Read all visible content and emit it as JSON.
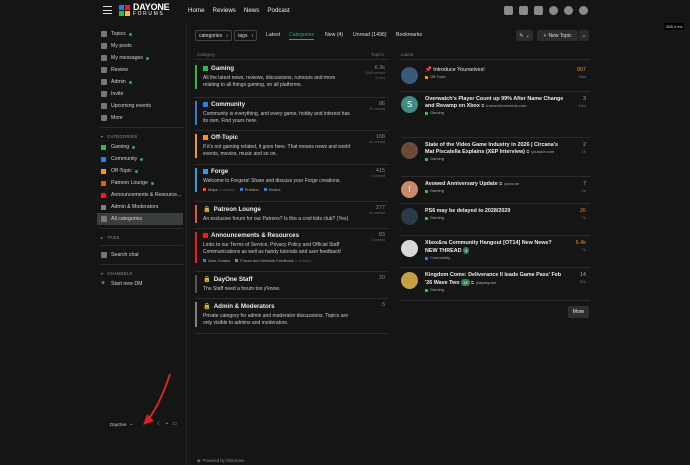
{
  "header": {
    "logo_top": "DAYONE",
    "logo_bottom": "FORUMS",
    "nav": [
      "Home",
      "Reviews",
      "News",
      "Podcast"
    ],
    "icons": [
      "youtube-icon",
      "x-icon",
      "discord-icon",
      "search-icon",
      "chat-icon",
      "user-avatar-icon"
    ],
    "tooltip": "358.4 ms"
  },
  "sidebar": {
    "main": [
      {
        "label": "Topics",
        "icon": "topics-icon",
        "dot": true
      },
      {
        "label": "My posts",
        "icon": "posts-icon",
        "dot": false
      },
      {
        "label": "My messages",
        "icon": "messages-icon",
        "dot": true
      },
      {
        "label": "Review",
        "icon": "review-icon",
        "dot": false
      },
      {
        "label": "Admin",
        "icon": "wrench-icon",
        "dot": true
      },
      {
        "label": "Invite",
        "icon": "invite-icon",
        "dot": false
      },
      {
        "label": "Upcoming events",
        "icon": "calendar-icon",
        "dot": false
      },
      {
        "label": "More",
        "icon": "more-icon",
        "dot": false
      }
    ],
    "categories_heading": "CATEGORIES",
    "categories": [
      {
        "label": "Gaming",
        "color": "#3ab54a",
        "dot": true
      },
      {
        "label": "Community",
        "color": "#2d7ed6",
        "dot": true
      },
      {
        "label": "Off-Topic",
        "color": "#f7941d",
        "dot": true
      },
      {
        "label": "Patreon Lounge",
        "color": "#e45735",
        "dot": true
      },
      {
        "label": "Announcements & Resource...",
        "color": "#ed1c24",
        "dot": true
      },
      {
        "label": "Admin & Moderators",
        "color": "#808281",
        "dot": false
      }
    ],
    "all_categories": "All categories",
    "tags_heading": "TAGS",
    "search_chat": "Search chat",
    "channels_heading": "CHANNELS",
    "start_dm": "Start new DM",
    "footer_label": "DayOne"
  },
  "navbar": {
    "categories_dd": "categories",
    "tags_dd": "tags",
    "tabs": [
      "Latest",
      "Categories",
      "New (4)",
      "Unread (1496)",
      "Bookmarks"
    ],
    "active_tab": "Categories",
    "new_topic": "New Topic"
  },
  "columns": {
    "category": "Category",
    "topics": "Topics",
    "latest": "Latest"
  },
  "categories": [
    {
      "name": "Gaming",
      "color": "#3ab54a",
      "desc": "All the latest news, reviews, discussions, rumours and more relating to all things gaming, on all platforms.",
      "count": "6.3k",
      "stat1": "2069 unread",
      "stat2": "4 new",
      "subs": []
    },
    {
      "name": "Community",
      "color": "#2d7ed6",
      "desc": "Community is everything, and every game, hobby and interest has its own. Find yours here.",
      "count": "86",
      "stat1": "29 unread",
      "stat2": "",
      "subs": []
    },
    {
      "name": "Off-Topic",
      "color": "#f7941d",
      "desc": "If it's not gaming related, it goes here. That means news and world events, movies, music and so on.",
      "count": "168",
      "stat1": "44 unread",
      "stat2": "",
      "subs": []
    },
    {
      "name": "Forge",
      "color": "#2d9fe0",
      "desc": "Welcome to Forgera! Share and discuss your Forge creations.",
      "count": "415",
      "stat1": "4 unread",
      "stat2": "",
      "subs": [
        {
          "label": "Maps",
          "color": "#e45735",
          "cnt": "1 unread"
        },
        {
          "label": "Prefabs",
          "color": "#2d7ed6",
          "cnt": ""
        },
        {
          "label": "Modes",
          "color": "#2d7ed6",
          "cnt": ""
        }
      ]
    },
    {
      "name": "Patreon Lounge",
      "color": "#e45735",
      "desc": "An exclusive forum for our Patrons? Is this a cool kids club? (Yes)",
      "count": "277",
      "stat1": "16 unread",
      "stat2": "",
      "subs": [],
      "locked": true
    },
    {
      "name": "Announcements & Resources",
      "color": "#ed1c24",
      "desc": "Links to our Terms of Service, Privacy Policy and Official Staff Communications as well as handy tutorials and user feedback!",
      "count": "83",
      "stat1": "2 unread",
      "stat2": "",
      "subs": [
        {
          "label": "User Guides",
          "color": "#2d7ed6",
          "cnt": ""
        },
        {
          "label": "Forum and Website Feedback",
          "color": "#808281",
          "cnt": "1 unread"
        }
      ]
    },
    {
      "name": "DayOne Staff",
      "color": "#555555",
      "desc": "The Staff need a forum too y'know.",
      "count": "20",
      "stat1": "",
      "stat2": "",
      "subs": [],
      "locked": true
    },
    {
      "name": "Admin & Moderators",
      "color": "#808281",
      "desc": "Private category for admin and moderator discussions. Topics are only visible to admins and moderators.",
      "count": "5",
      "stat1": "",
      "stat2": "",
      "subs": [],
      "locked": true
    }
  ],
  "topics": [
    {
      "title": "Introduce Yourselves!",
      "bold": false,
      "pinned": true,
      "source": "",
      "category": "Off-Topic",
      "cat_color": "#f7941d",
      "count": "907",
      "hot": true,
      "age": "18m",
      "avatar": "#3a5a7a",
      "letter": ""
    },
    {
      "title": "Overwatch's Player Count up 99% After Name Change and Revamp on Xbox",
      "bold": true,
      "pinned": false,
      "source": "trueachievements.com",
      "category": "Gaming",
      "cat_color": "#3ab54a",
      "count": "3",
      "hot": false,
      "age": "43m",
      "avatar": "#3f8c87",
      "letter": "S"
    },
    {
      "title": "State of the Video Game Industry in 2026 | Circana's Mat Piscatella Explains (XEP Interview)",
      "bold": true,
      "pinned": false,
      "source": "youtube.com",
      "category": "Gaming",
      "cat_color": "#3ab54a",
      "count": "2",
      "hot": false,
      "age": "1h",
      "avatar": "#6b4a3a",
      "letter": ""
    },
    {
      "title": "Avowed Anniversary Update",
      "bold": true,
      "pinned": false,
      "source": "youtu.be",
      "category": "Gaming",
      "cat_color": "#3ab54a",
      "count": "7",
      "hot": false,
      "age": "2h",
      "avatar": "#c9896a",
      "letter": "I"
    },
    {
      "title": "PS6 may be delayed to 2028/2029",
      "bold": true,
      "pinned": false,
      "source": "",
      "category": "Gaming",
      "cat_color": "#3ab54a",
      "count": "26",
      "hot": true,
      "age": "7h",
      "avatar": "#2d3a4a",
      "letter": ""
    },
    {
      "title": "Xbox&ra Community Hangout [OT14] New News? NEW THREAD",
      "bold": true,
      "pinned": false,
      "source": "",
      "category": "Community",
      "cat_color": "#2d7ed6",
      "count": "6.4k",
      "hot": true,
      "age": "7h",
      "avatar": "#d8d8d8",
      "letter": "",
      "badge": "4"
    },
    {
      "title": "Kingdom Come: Deliverance II leads Game Pass' Feb '26 Wave Two",
      "bold": true,
      "pinned": false,
      "source": "playdayone",
      "category": "Gaming",
      "cat_color": "#3ab54a",
      "count": "14",
      "hot": false,
      "age": "10h",
      "avatar": "#c7a046",
      "letter": "",
      "badge": "13"
    }
  ],
  "more_label": "More",
  "powered": "Powered by Discourse"
}
